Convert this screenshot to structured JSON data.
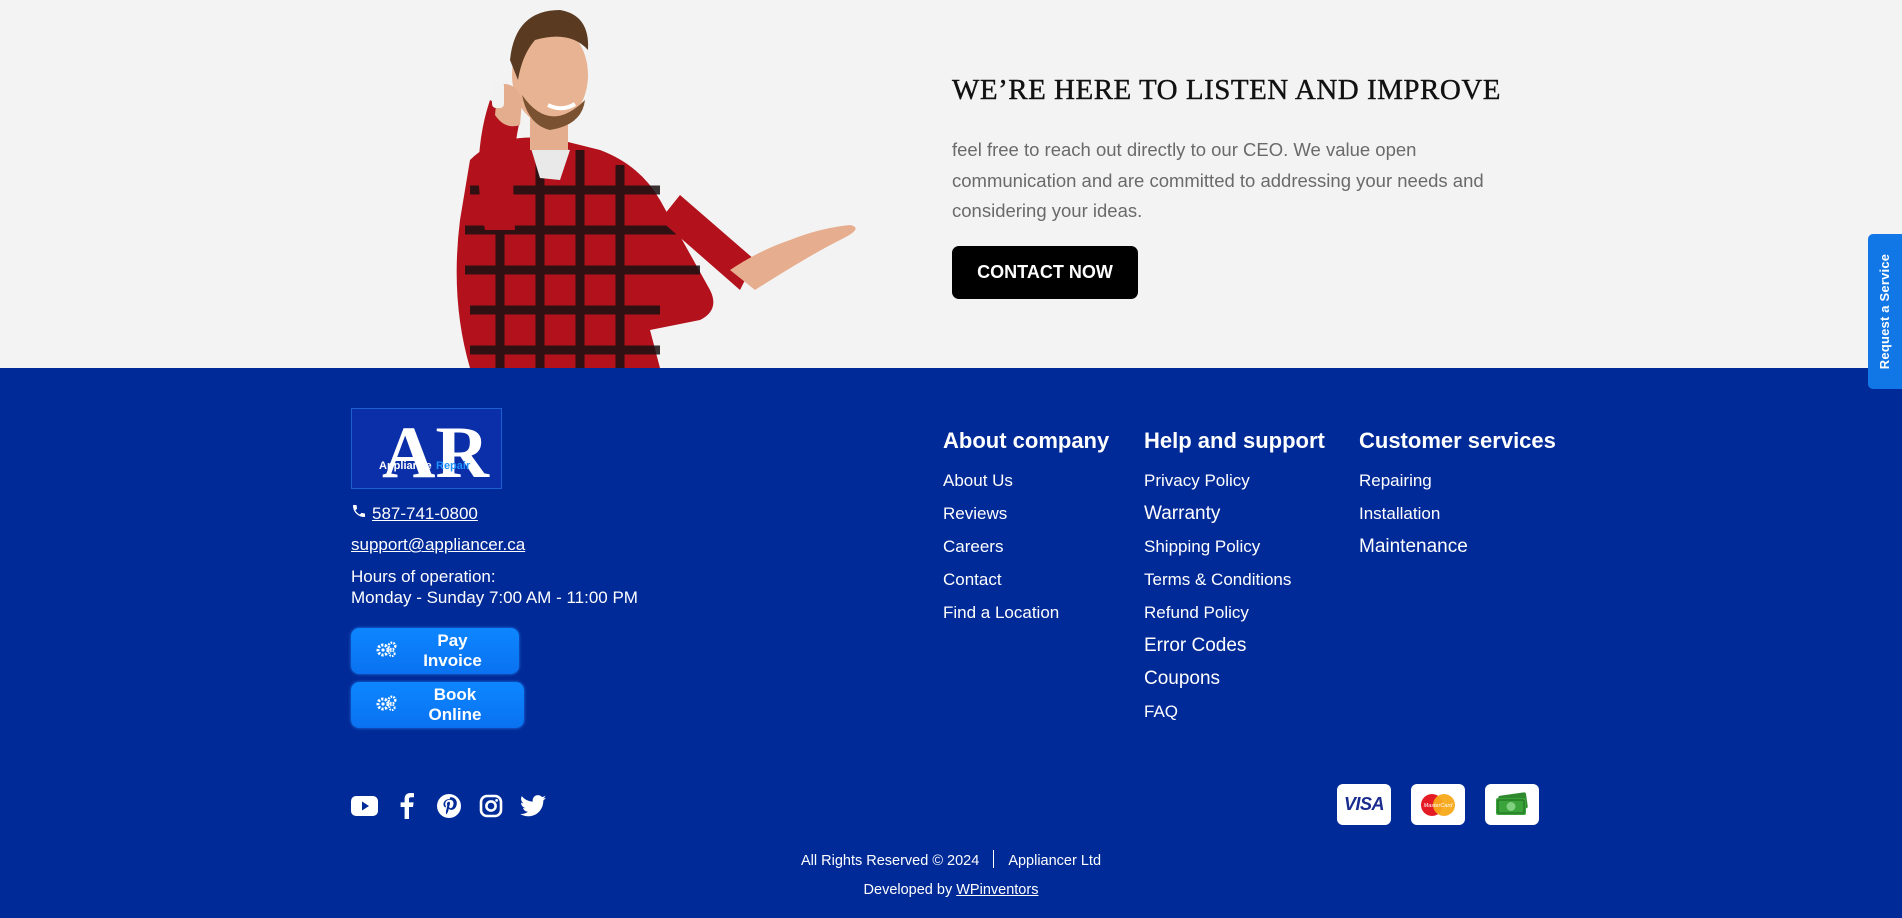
{
  "cta": {
    "title": "WE’RE HERE TO LISTEN AND IMPROVE",
    "text": "feel free to reach out directly to our CEO. We value open communication and are committed to addressing your needs and considering your ideas.",
    "button_label": "CONTACT NOW"
  },
  "side_tab": {
    "label": "Request a Service"
  },
  "footer": {
    "logo": {
      "letters": "AR",
      "word1": "Appliance",
      "word2": "Repair"
    },
    "phone": "587-741-0800",
    "email": "support@appliancer.ca",
    "hours_label": "Hours of operation:",
    "hours_value": "Monday - Sunday 7:00 AM - 11:00 PM",
    "pay_invoice_label": "Pay Invoice",
    "book_online_label": "Book Online",
    "columns": [
      {
        "title": "About company",
        "items": [
          "About Us",
          "Reviews",
          "Careers",
          "Contact",
          "Find a Location"
        ]
      },
      {
        "title": "Help and support",
        "items": [
          "Privacy Policy",
          "Warranty",
          "Shipping Policy",
          "Terms & Conditions",
          "Refund Policy",
          "Error Codes",
          "Coupons",
          "FAQ"
        ]
      },
      {
        "title": "Customer services",
        "items": [
          "Repairing",
          "Installation",
          "Maintenance"
        ]
      }
    ],
    "social_icons": [
      "youtube-icon",
      "facebook-icon",
      "pinterest-icon",
      "instagram-icon",
      "twitter-icon"
    ],
    "payment_icons": [
      "visa-icon",
      "mastercard-icon",
      "cash-icon"
    ],
    "payment": {
      "visa": "VISA",
      "mastercard": "MasterCard"
    },
    "copyright": "All Rights Reserved © 2024",
    "company": "Appliancer Ltd",
    "developed_by_label": "Developed by",
    "developer": "WPinventors"
  },
  "colors": {
    "footer_bg": "#002a97",
    "cta_bg": "#f3f3f3",
    "accent_button": "#0d86ff",
    "side_tab": "#1177e6"
  }
}
